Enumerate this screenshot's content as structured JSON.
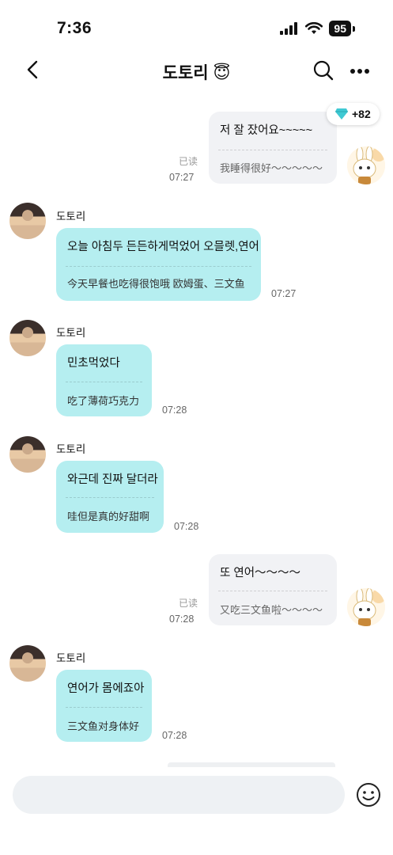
{
  "status_bar": {
    "time": "7:36",
    "battery": "95"
  },
  "header": {
    "title": "도토리 😇"
  },
  "points_badge": {
    "value": "+82"
  },
  "messages": [
    {
      "from": "me",
      "text": "저 잘 잤어요~~~~~",
      "translation": "我睡得很好～～～～～",
      "read": "已读",
      "time": "07:27"
    },
    {
      "from": "her",
      "sender": "도토리",
      "text": "오늘 아침두 든든하게먹었어 오믈렛,연어",
      "translation": "今天早餐也吃得很饱哦 欧姆蛋、三文鱼",
      "time": "07:27"
    },
    {
      "from": "her",
      "sender": "도토리",
      "text": "민초먹었다",
      "translation": "吃了薄荷巧克力",
      "time": "07:28"
    },
    {
      "from": "her",
      "sender": "도토리",
      "text": "와근데 진짜 달더라",
      "translation": "哇但是真的好甜啊",
      "time": "07:28"
    },
    {
      "from": "me",
      "text": "또 연어～～～～",
      "translation": "又吃三文鱼啦～～～～",
      "read": "已读",
      "time": "07:28"
    },
    {
      "from": "her",
      "sender": "도토리",
      "text": "연어가 몸에죠아",
      "translation": "三文鱼对身体好",
      "time": "07:28"
    }
  ],
  "colors": {
    "her_bubble": "#b5eef0",
    "my_bubble": "#f1f2f5",
    "badge_gem": "#3fc9d3"
  },
  "icons": [
    "back-icon",
    "search-icon",
    "more-icon",
    "gem-icon",
    "emoji-icon"
  ]
}
